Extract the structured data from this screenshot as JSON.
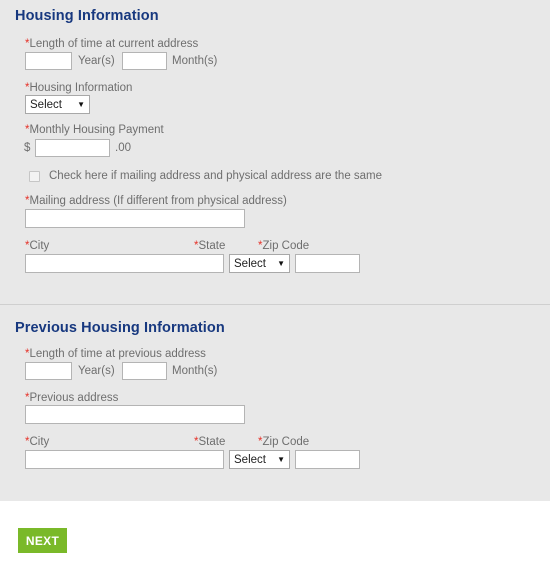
{
  "sections": [
    {
      "heading": "Housing Information",
      "fields": {
        "length_label": "Length of time at current address",
        "years_value": "",
        "years_suffix": "Year(s)",
        "months_value": "",
        "months_suffix": "Month(s)",
        "housing_type_label": "Housing Information",
        "housing_type_value": "Select",
        "payment_label": "Monthly Housing Payment",
        "currency_symbol": "$",
        "payment_value": "",
        "cents_suffix": ".00",
        "same_address_checkbox_label": "Check here if mailing address and physical address are the same",
        "mailing_label": "Mailing address (If different from physical address)",
        "mailing_value": "",
        "city_label": "City",
        "city_value": "",
        "state_label": "State",
        "state_value": "Select",
        "zip_label": "Zip Code",
        "zip_value": ""
      }
    },
    {
      "heading": "Previous Housing Information",
      "fields": {
        "length_label": "Length of time at previous address",
        "years_value": "",
        "years_suffix": "Year(s)",
        "months_value": "",
        "months_suffix": "Month(s)",
        "address_label": "Previous address",
        "address_value": "",
        "city_label": "City",
        "city_value": "",
        "state_label": "State",
        "state_value": "Select",
        "zip_label": "Zip Code",
        "zip_value": ""
      }
    }
  ],
  "footer": {
    "next_label": "NEXT"
  },
  "icons": {
    "chevron_down": "▼",
    "required_marker": "*"
  },
  "colors": {
    "heading": "#17387f",
    "required": "#e5332a",
    "panel_background": "#e8e8e8",
    "next_button": "#7ab929",
    "label_text": "#6e6e6e"
  }
}
